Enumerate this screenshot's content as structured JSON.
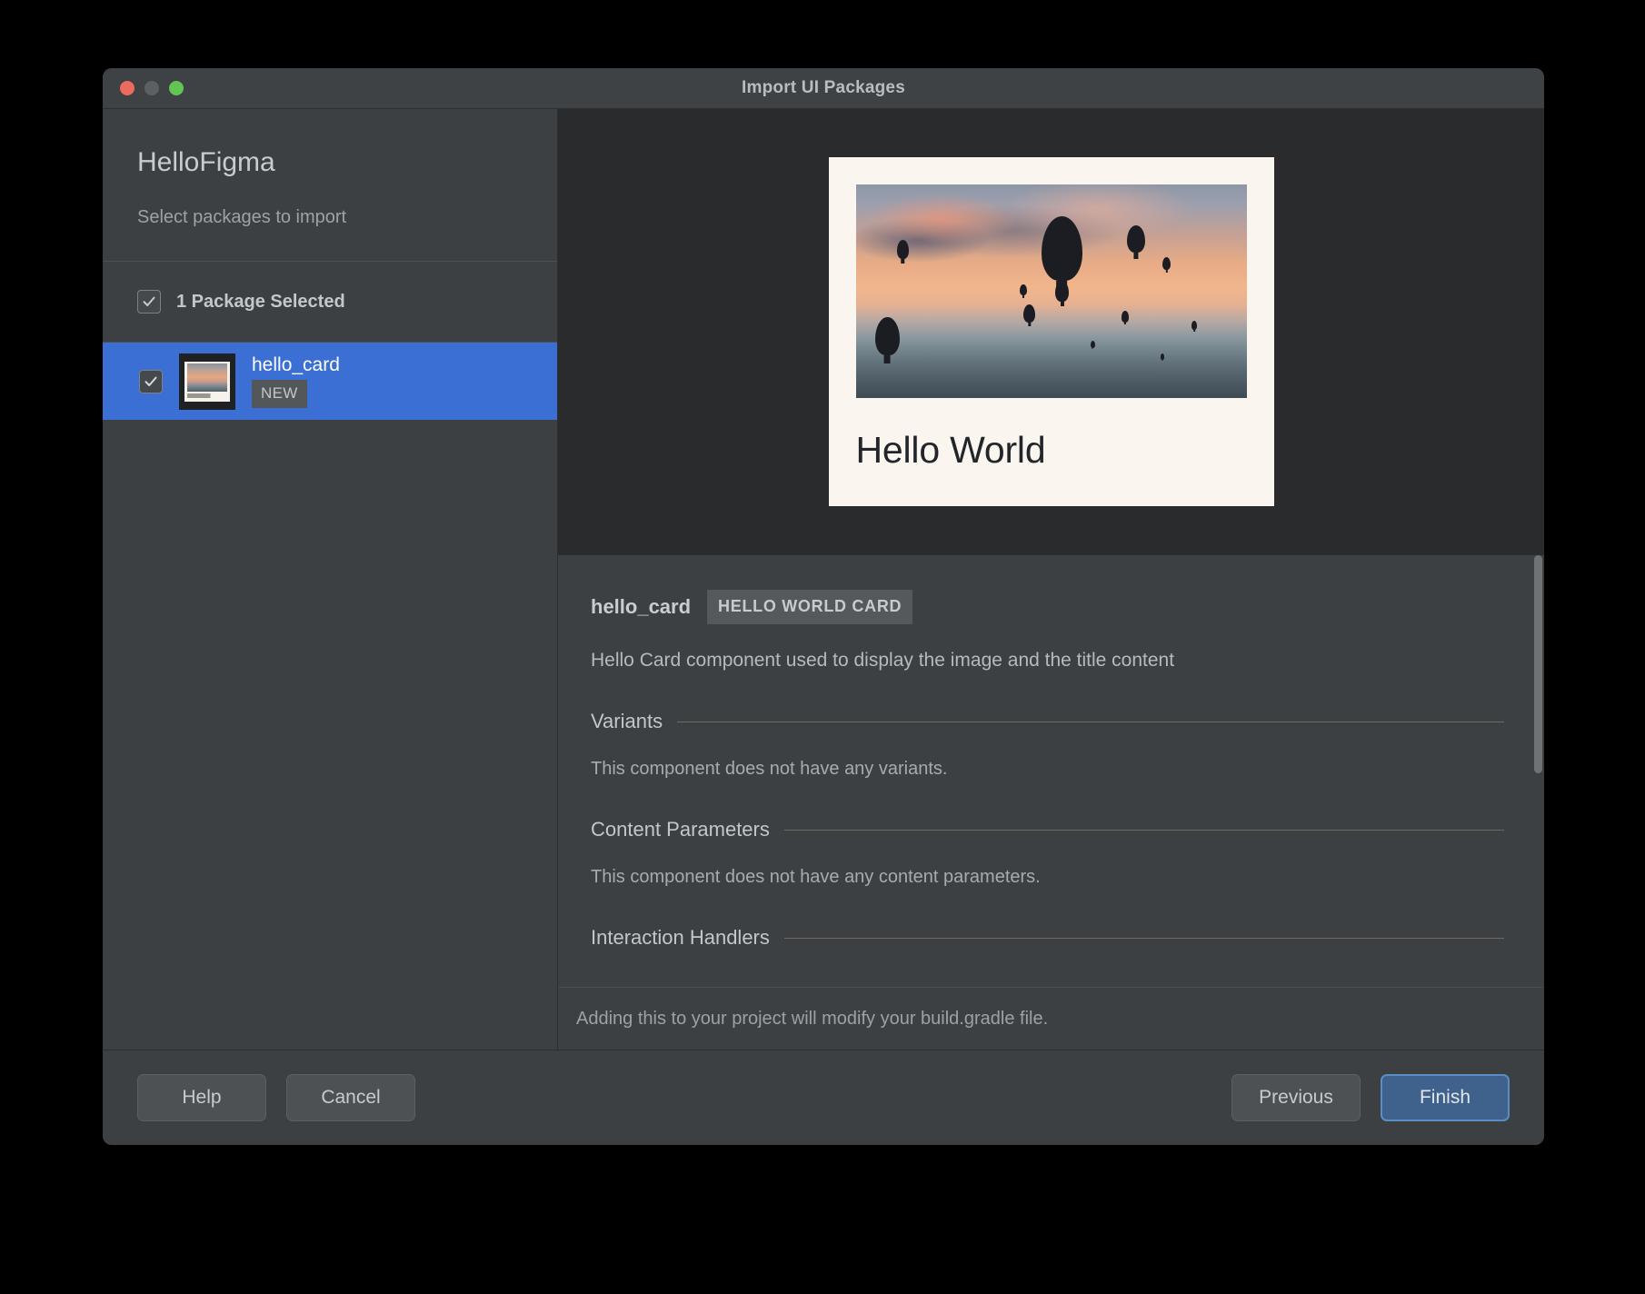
{
  "window": {
    "title": "Import UI Packages",
    "traffic_lights": [
      "close-button",
      "minimize-button",
      "zoom-button"
    ]
  },
  "sidebar": {
    "project_name": "HelloFigma",
    "subtitle": "Select packages to import",
    "select_all": {
      "label": "1 Package Selected",
      "checked": true
    },
    "packages": [
      {
        "name": "hello_card",
        "badge": "NEW",
        "checked": true,
        "selected": true
      }
    ]
  },
  "preview": {
    "card_title": "Hello World",
    "image_alt": "hot-air-balloons-at-sunset"
  },
  "details": {
    "component_name": "hello_card",
    "component_tag": "HELLO WORLD CARD",
    "description": "Hello Card component used to display the image and the title content",
    "sections": [
      {
        "title": "Variants",
        "body": "This component does not have any variants."
      },
      {
        "title": "Content Parameters",
        "body": "This component does not have any content parameters."
      },
      {
        "title": "Interaction Handlers",
        "body": ""
      }
    ],
    "note": "Adding this to your project will modify your build.gradle file."
  },
  "footer": {
    "help_label": "Help",
    "cancel_label": "Cancel",
    "previous_label": "Previous",
    "finish_label": "Finish"
  },
  "colors": {
    "window_bg": "#3c4043",
    "preview_bg": "#2a2b2c",
    "selection_blue": "#3b6fd4",
    "primary_button": "#3f628d",
    "card_bg": "#faf5ee",
    "traffic_red": "#ed6a5e",
    "traffic_yellow": "#5c6063",
    "traffic_green": "#61c454"
  }
}
